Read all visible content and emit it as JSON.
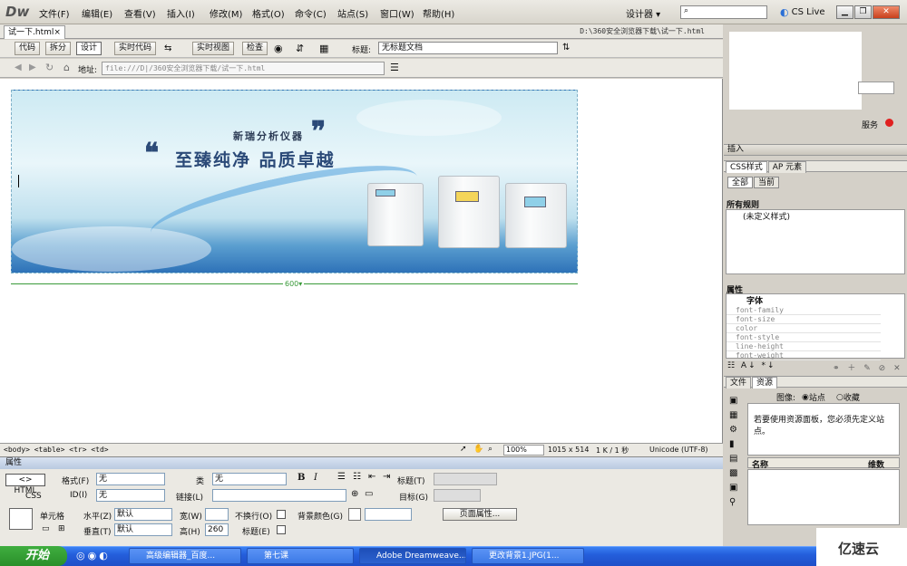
{
  "app": {
    "logo": "Dw",
    "workspace": "设计器 ▾",
    "cslive": "CS Live"
  },
  "menu": [
    "文件(F)",
    "编辑(E)",
    "查看(V)",
    "插入(I)",
    "修改(M)",
    "格式(O)",
    "命令(C)",
    "站点(S)",
    "窗口(W)",
    "帮助(H)"
  ],
  "document": {
    "tab": "试一下.html×",
    "path": "D:\\360安全浏览器下载\\试一下.html"
  },
  "toolbar": {
    "buttons": [
      "代码",
      "拆分",
      "设计",
      "实时代码",
      "实时视图",
      "检查"
    ],
    "title_label": "标题:",
    "title_value": "无标题文档"
  },
  "address": {
    "label": "地址:",
    "value": "file:///D|/360安全浏览器下载/试一下.html"
  },
  "banner": {
    "brand": "新瑞分析仪器",
    "slogan": "至臻纯净 品质卓越",
    "width_label": "600▾"
  },
  "status": {
    "tags": "<body> <table> <tr> <td>",
    "zoom": "100%",
    "dims": "1015 x 514",
    "size_time": "1 K / 1 秒",
    "encoding": "Unicode (UTF-8)"
  },
  "properties": {
    "header": "属性",
    "html_btn": "<> HTML",
    "css_btn": "CSS",
    "format_label": "格式(F)",
    "format_value": "无",
    "class_label": "类",
    "class_value": "无",
    "id_label": "ID(I)",
    "id_value": "无",
    "link_label": "链接(L)",
    "title_label": "标题(T)",
    "target_label": "目标(G)",
    "cell_label": "单元格",
    "horz_label": "水平(Z)",
    "horz_value": "默认",
    "vert_label": "垂直(T)",
    "vert_value": "默认",
    "width_label": "宽(W)",
    "height_label": "高(H)",
    "height_value": "260",
    "nowrap_label": "不换行(O)",
    "header_label": "标题(E)",
    "bgcolor_label": "背景颜色(G)",
    "page_props": "页面属性..."
  },
  "right": {
    "service": "服务",
    "insert": "插入",
    "css_tabs": [
      "CSS样式",
      "AP 元素"
    ],
    "css_mode": [
      "全部",
      "当前"
    ],
    "all_rules": "所有规则",
    "rule": "(未定义样式)",
    "attr_header": "属性",
    "font_group": "字体",
    "font_props": [
      "font-family",
      "font-size",
      "color",
      "font-style",
      "line-height",
      "font-weight"
    ],
    "files_tabs": [
      "文件",
      "资源"
    ],
    "image_label": "图像:",
    "site_radio": "站点",
    "fav_radio": "收藏",
    "asset_msg": "若要使用资源面板，您必须先定义站点。",
    "col_name": "名称",
    "col_dims": "维数"
  },
  "taskbar": {
    "start": "开始",
    "tasks": [
      "高级编辑器_百度...",
      "第七课",
      "Adobe Dreamweave...",
      "更改背景1.JPG(1..."
    ]
  },
  "watermark": "亿速云",
  "colors": {
    "taskbar": "#245edb",
    "start": "#2a8f2a",
    "ruler": "#3a9a3a"
  }
}
